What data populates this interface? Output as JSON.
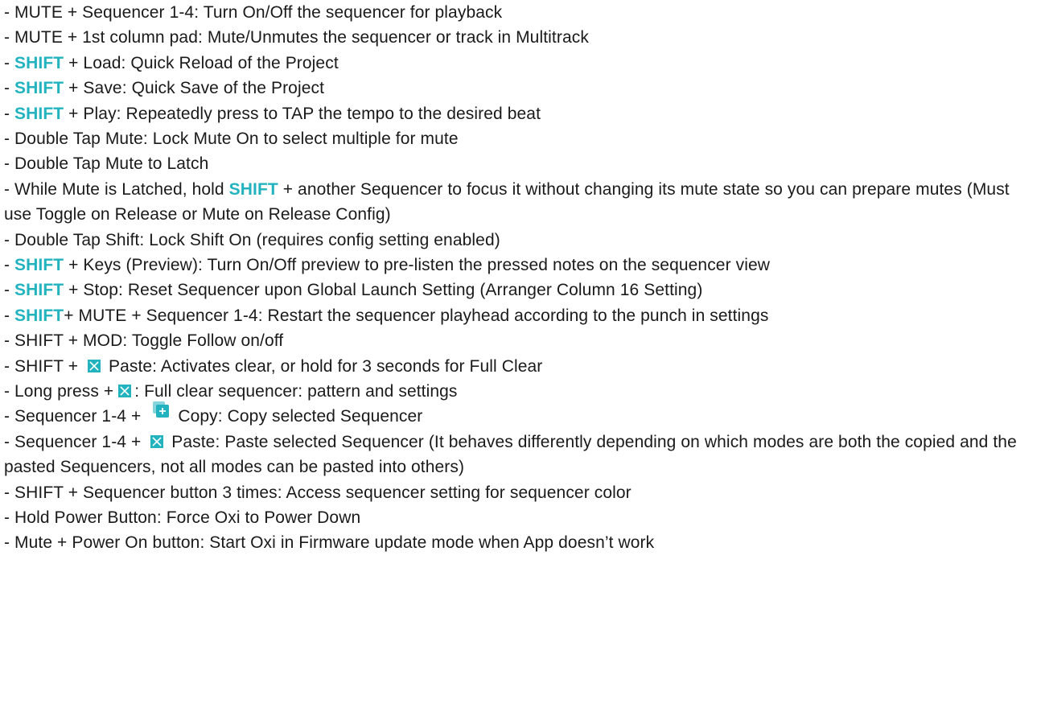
{
  "theme": {
    "accent": "#22b3bf",
    "text": "#1a1a1a",
    "background": "#ffffff"
  },
  "icons": {
    "clear": "clear-x-icon",
    "copy": "copy-plus-icon"
  },
  "lines": [
    {
      "id": "l1",
      "segments": [
        {
          "t": "- MUTE + Sequencer 1-4: Turn On/Off the sequencer for playback"
        }
      ]
    },
    {
      "id": "l2",
      "segments": [
        {
          "t": "- MUTE + 1st column pad: Mute/Unmutes the sequencer or track in Multitrack"
        }
      ]
    },
    {
      "id": "l3",
      "segments": [
        {
          "t": "- "
        },
        {
          "t": "SHIFT",
          "k": true
        },
        {
          "t": " + Load: Quick Reload of the Project"
        }
      ]
    },
    {
      "id": "l4",
      "segments": [
        {
          "t": "- "
        },
        {
          "t": "SHIFT",
          "k": true
        },
        {
          "t": " + Save: Quick Save of the Project"
        }
      ]
    },
    {
      "id": "l5",
      "segments": [
        {
          "t": "- "
        },
        {
          "t": "SHIFT",
          "k": true
        },
        {
          "t": " + Play: Repeatedly press to TAP the tempo to the desired beat"
        }
      ]
    },
    {
      "id": "l6",
      "segments": [
        {
          "t": "- Double Tap Mute: Lock Mute On to select multiple for mute"
        }
      ]
    },
    {
      "id": "l7",
      "segments": [
        {
          "t": "- Double Tap Mute to Latch"
        }
      ]
    },
    {
      "id": "l8",
      "wrap": true,
      "segments": [
        {
          "t": "- While Mute is Latched, hold "
        },
        {
          "t": "SHIFT",
          "k": true
        },
        {
          "t": " + another Sequencer to focus it without changing its mute state so you can prepare mutes (Must use Toggle on Release or Mute on Release Config)"
        }
      ]
    },
    {
      "id": "l9",
      "segments": [
        {
          "t": "- Double Tap Shift: Lock Shift On (requires config setting enabled)"
        }
      ]
    },
    {
      "id": "l10",
      "wrap": true,
      "segments": [
        {
          "t": "- "
        },
        {
          "t": "SHIFT",
          "k": true
        },
        {
          "t": " + Keys (Preview): Turn On/Off preview to pre-listen the pressed notes on the sequencer view"
        }
      ]
    },
    {
      "id": "l11",
      "segments": [
        {
          "t": "- "
        },
        {
          "t": "SHIFT",
          "k": true
        },
        {
          "t": " + Stop: Reset Sequencer upon Global Launch Setting (Arranger Column 16 Setting)"
        }
      ]
    },
    {
      "id": "l12",
      "wrap": true,
      "segments": [
        {
          "t": "- "
        },
        {
          "t": "SHIFT",
          "k": true
        },
        {
          "t": "+ MUTE + Sequencer 1-4: Restart the sequencer playhead according to the punch in settings"
        }
      ]
    },
    {
      "id": "l13",
      "segments": [
        {
          "t": "- SHIFT + MOD: Toggle Follow on/off"
        }
      ]
    },
    {
      "id": "l14",
      "segments": [
        {
          "t": "- SHIFT + "
        },
        {
          "icon": "clear"
        },
        {
          "t": " Paste: Activates clear, or hold for 3 seconds for Full Clear"
        }
      ]
    },
    {
      "id": "l15",
      "segments": [
        {
          "t": "- Long press +"
        },
        {
          "icon": "clear"
        },
        {
          "t": ": Full clear sequencer: pattern and settings"
        }
      ]
    },
    {
      "id": "l16",
      "segments": [
        {
          "t": "- Sequencer 1-4 + "
        },
        {
          "icon": "copy"
        },
        {
          "t": "Copy: Copy selected Sequencer"
        }
      ]
    },
    {
      "id": "l17",
      "wrap": true,
      "segments": [
        {
          "t": "- Sequencer 1-4 + "
        },
        {
          "icon": "clear"
        },
        {
          "t": " Paste: Paste selected Sequencer (It behaves differently depending on which modes are both the copied and the pasted Sequencers, not all modes can be pasted into others)"
        }
      ]
    },
    {
      "id": "l18",
      "segments": [
        {
          "t": "- SHIFT + Sequencer button 3 times: Access sequencer setting for sequencer color"
        }
      ]
    },
    {
      "id": "l19",
      "segments": [
        {
          "t": "- Hold Power Button: Force Oxi to Power Down"
        }
      ]
    },
    {
      "id": "l20",
      "segments": [
        {
          "t": "- Mute + Power On button: Start Oxi in Firmware update mode when App doesn’t work"
        }
      ]
    }
  ]
}
